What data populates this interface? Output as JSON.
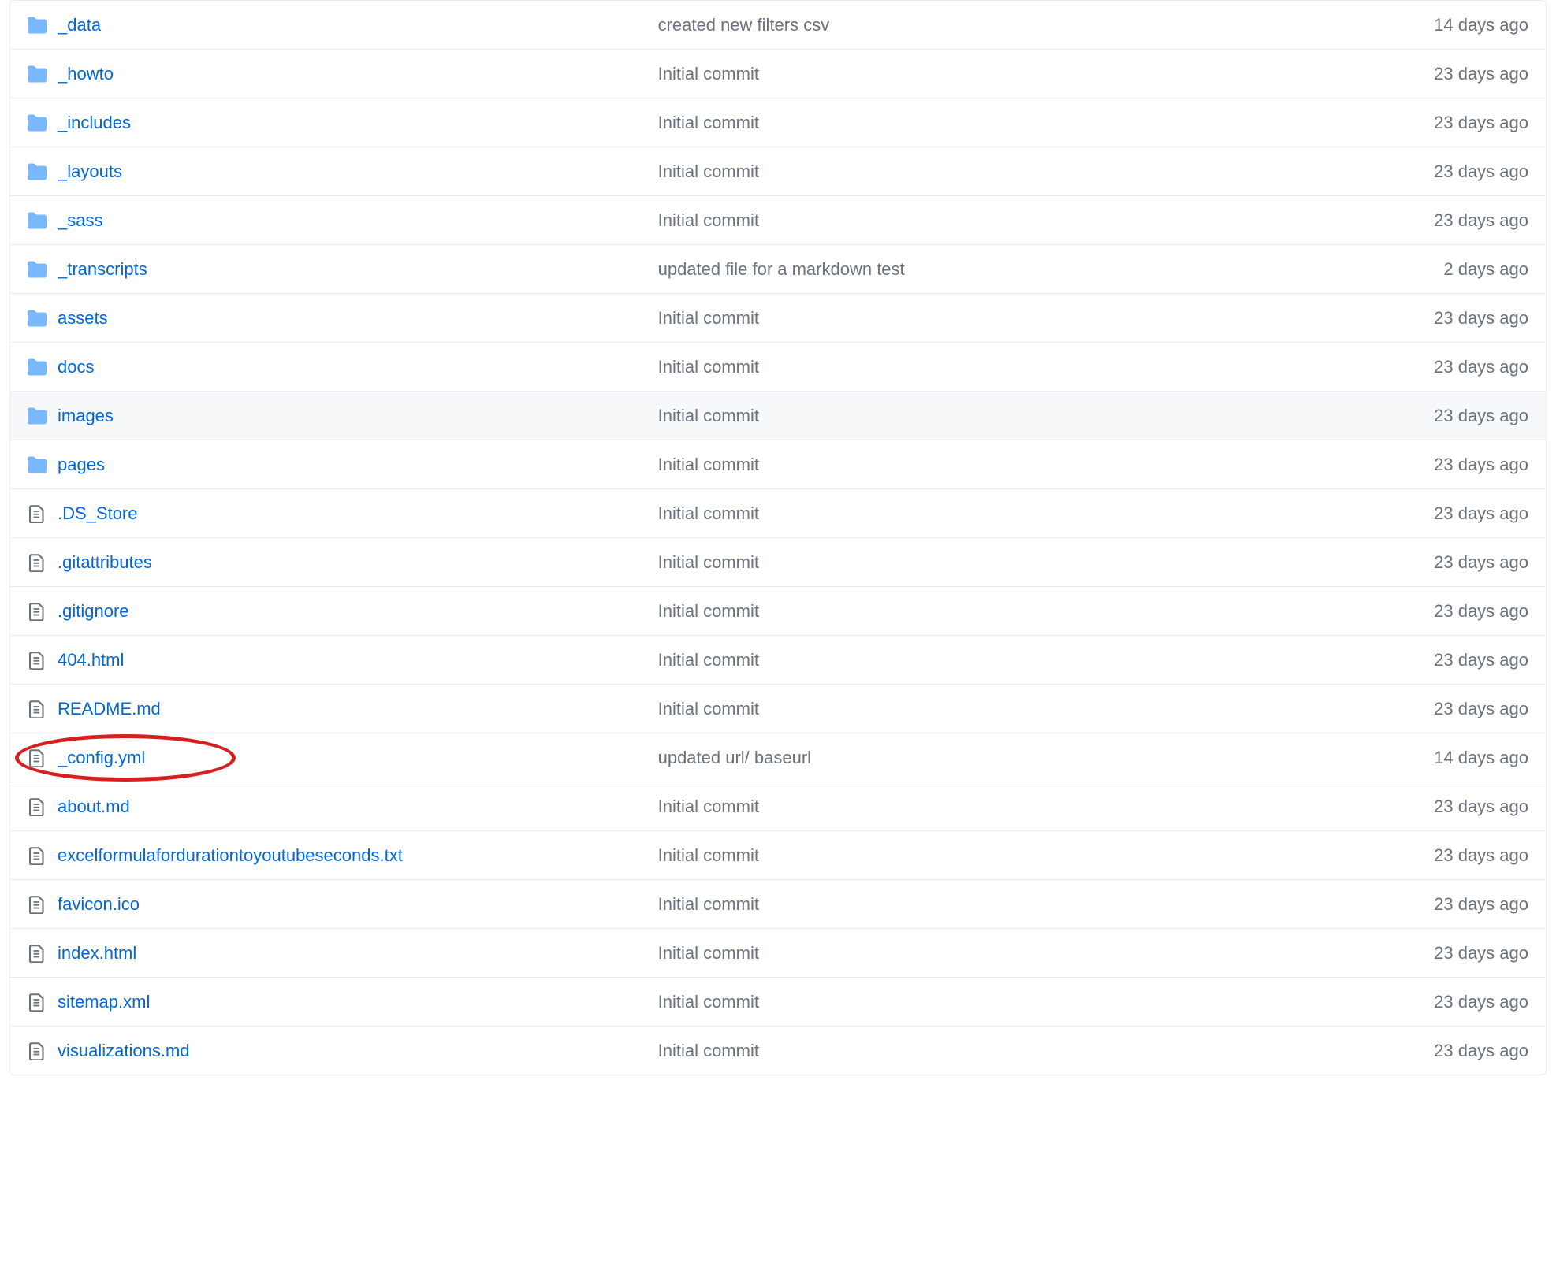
{
  "files": [
    {
      "type": "dir",
      "name": "_data",
      "commit": "created new filters csv",
      "age": "14 days ago",
      "circled": false,
      "hovered": false
    },
    {
      "type": "dir",
      "name": "_howto",
      "commit": "Initial commit",
      "age": "23 days ago",
      "circled": false,
      "hovered": false
    },
    {
      "type": "dir",
      "name": "_includes",
      "commit": "Initial commit",
      "age": "23 days ago",
      "circled": false,
      "hovered": false
    },
    {
      "type": "dir",
      "name": "_layouts",
      "commit": "Initial commit",
      "age": "23 days ago",
      "circled": false,
      "hovered": false
    },
    {
      "type": "dir",
      "name": "_sass",
      "commit": "Initial commit",
      "age": "23 days ago",
      "circled": false,
      "hovered": false
    },
    {
      "type": "dir",
      "name": "_transcripts",
      "commit": "updated file for a markdown test",
      "age": "2 days ago",
      "circled": false,
      "hovered": false
    },
    {
      "type": "dir",
      "name": "assets",
      "commit": "Initial commit",
      "age": "23 days ago",
      "circled": false,
      "hovered": false
    },
    {
      "type": "dir",
      "name": "docs",
      "commit": "Initial commit",
      "age": "23 days ago",
      "circled": false,
      "hovered": false
    },
    {
      "type": "dir",
      "name": "images",
      "commit": "Initial commit",
      "age": "23 days ago",
      "circled": false,
      "hovered": true
    },
    {
      "type": "dir",
      "name": "pages",
      "commit": "Initial commit",
      "age": "23 days ago",
      "circled": false,
      "hovered": false
    },
    {
      "type": "file",
      "name": ".DS_Store",
      "commit": "Initial commit",
      "age": "23 days ago",
      "circled": false,
      "hovered": false
    },
    {
      "type": "file",
      "name": ".gitattributes",
      "commit": "Initial commit",
      "age": "23 days ago",
      "circled": false,
      "hovered": false
    },
    {
      "type": "file",
      "name": ".gitignore",
      "commit": "Initial commit",
      "age": "23 days ago",
      "circled": false,
      "hovered": false
    },
    {
      "type": "file",
      "name": "404.html",
      "commit": "Initial commit",
      "age": "23 days ago",
      "circled": false,
      "hovered": false
    },
    {
      "type": "file",
      "name": "README.md",
      "commit": "Initial commit",
      "age": "23 days ago",
      "circled": false,
      "hovered": false
    },
    {
      "type": "file",
      "name": "_config.yml",
      "commit": "updated url/ baseurl",
      "age": "14 days ago",
      "circled": true,
      "hovered": false
    },
    {
      "type": "file",
      "name": "about.md",
      "commit": "Initial commit",
      "age": "23 days ago",
      "circled": false,
      "hovered": false
    },
    {
      "type": "file",
      "name": "excelformulafordurationtoyoutubeseconds.txt",
      "commit": "Initial commit",
      "age": "23 days ago",
      "circled": false,
      "hovered": false
    },
    {
      "type": "file",
      "name": "favicon.ico",
      "commit": "Initial commit",
      "age": "23 days ago",
      "circled": false,
      "hovered": false
    },
    {
      "type": "file",
      "name": "index.html",
      "commit": "Initial commit",
      "age": "23 days ago",
      "circled": false,
      "hovered": false
    },
    {
      "type": "file",
      "name": "sitemap.xml",
      "commit": "Initial commit",
      "age": "23 days ago",
      "circled": false,
      "hovered": false
    },
    {
      "type": "file",
      "name": "visualizations.md",
      "commit": "Initial commit",
      "age": "23 days ago",
      "circled": false,
      "hovered": false
    }
  ],
  "colors": {
    "link": "#0366d6",
    "muted": "#6a737d",
    "folder_icon": "#79b8ff",
    "border": "#eaecef",
    "annotation": "#d62020"
  }
}
